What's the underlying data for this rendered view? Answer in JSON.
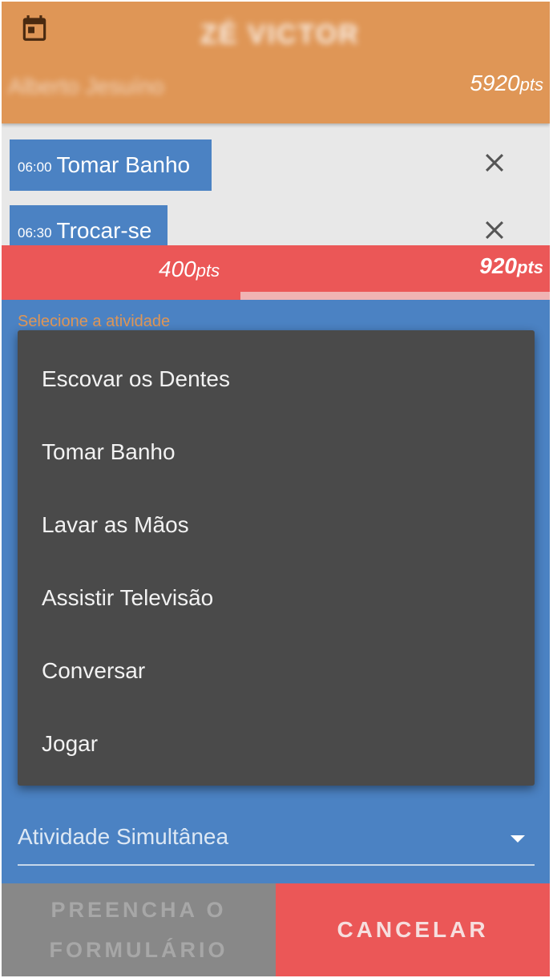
{
  "header": {
    "user_name": "ZÉ VICTOR",
    "subtitle": "Alberto Jesuíno",
    "total_points": "5920",
    "total_points_unit": "pts"
  },
  "activities": [
    {
      "time": "06:00",
      "label": "Tomar Banho"
    },
    {
      "time": "06:30",
      "label": "Trocar-se"
    }
  ],
  "points": {
    "current": "400",
    "goal": "920",
    "unit": "pts",
    "progress_fraction": 0.435
  },
  "form": {
    "activity_label": "Selecione a atividade",
    "dropdown_options": [
      "Escovar os Dentes",
      "Tomar Banho",
      "Lavar as Mãos",
      "Assistir Televisão",
      "Conversar",
      "Jogar"
    ],
    "simultaneous_label": "Atividade Simultânea"
  },
  "buttons": {
    "fill_form": "PREENCHA O FORMULÁRIO",
    "cancel": "CANCELAR"
  },
  "colors": {
    "header": "#df9656",
    "activity": "#4b82c3",
    "points_bar": "#eb5757",
    "dropdown": "#4a4a4a",
    "disabled_button": "#888888"
  },
  "icons": [
    "calendar-icon",
    "close-icon",
    "chevron-down-icon"
  ]
}
